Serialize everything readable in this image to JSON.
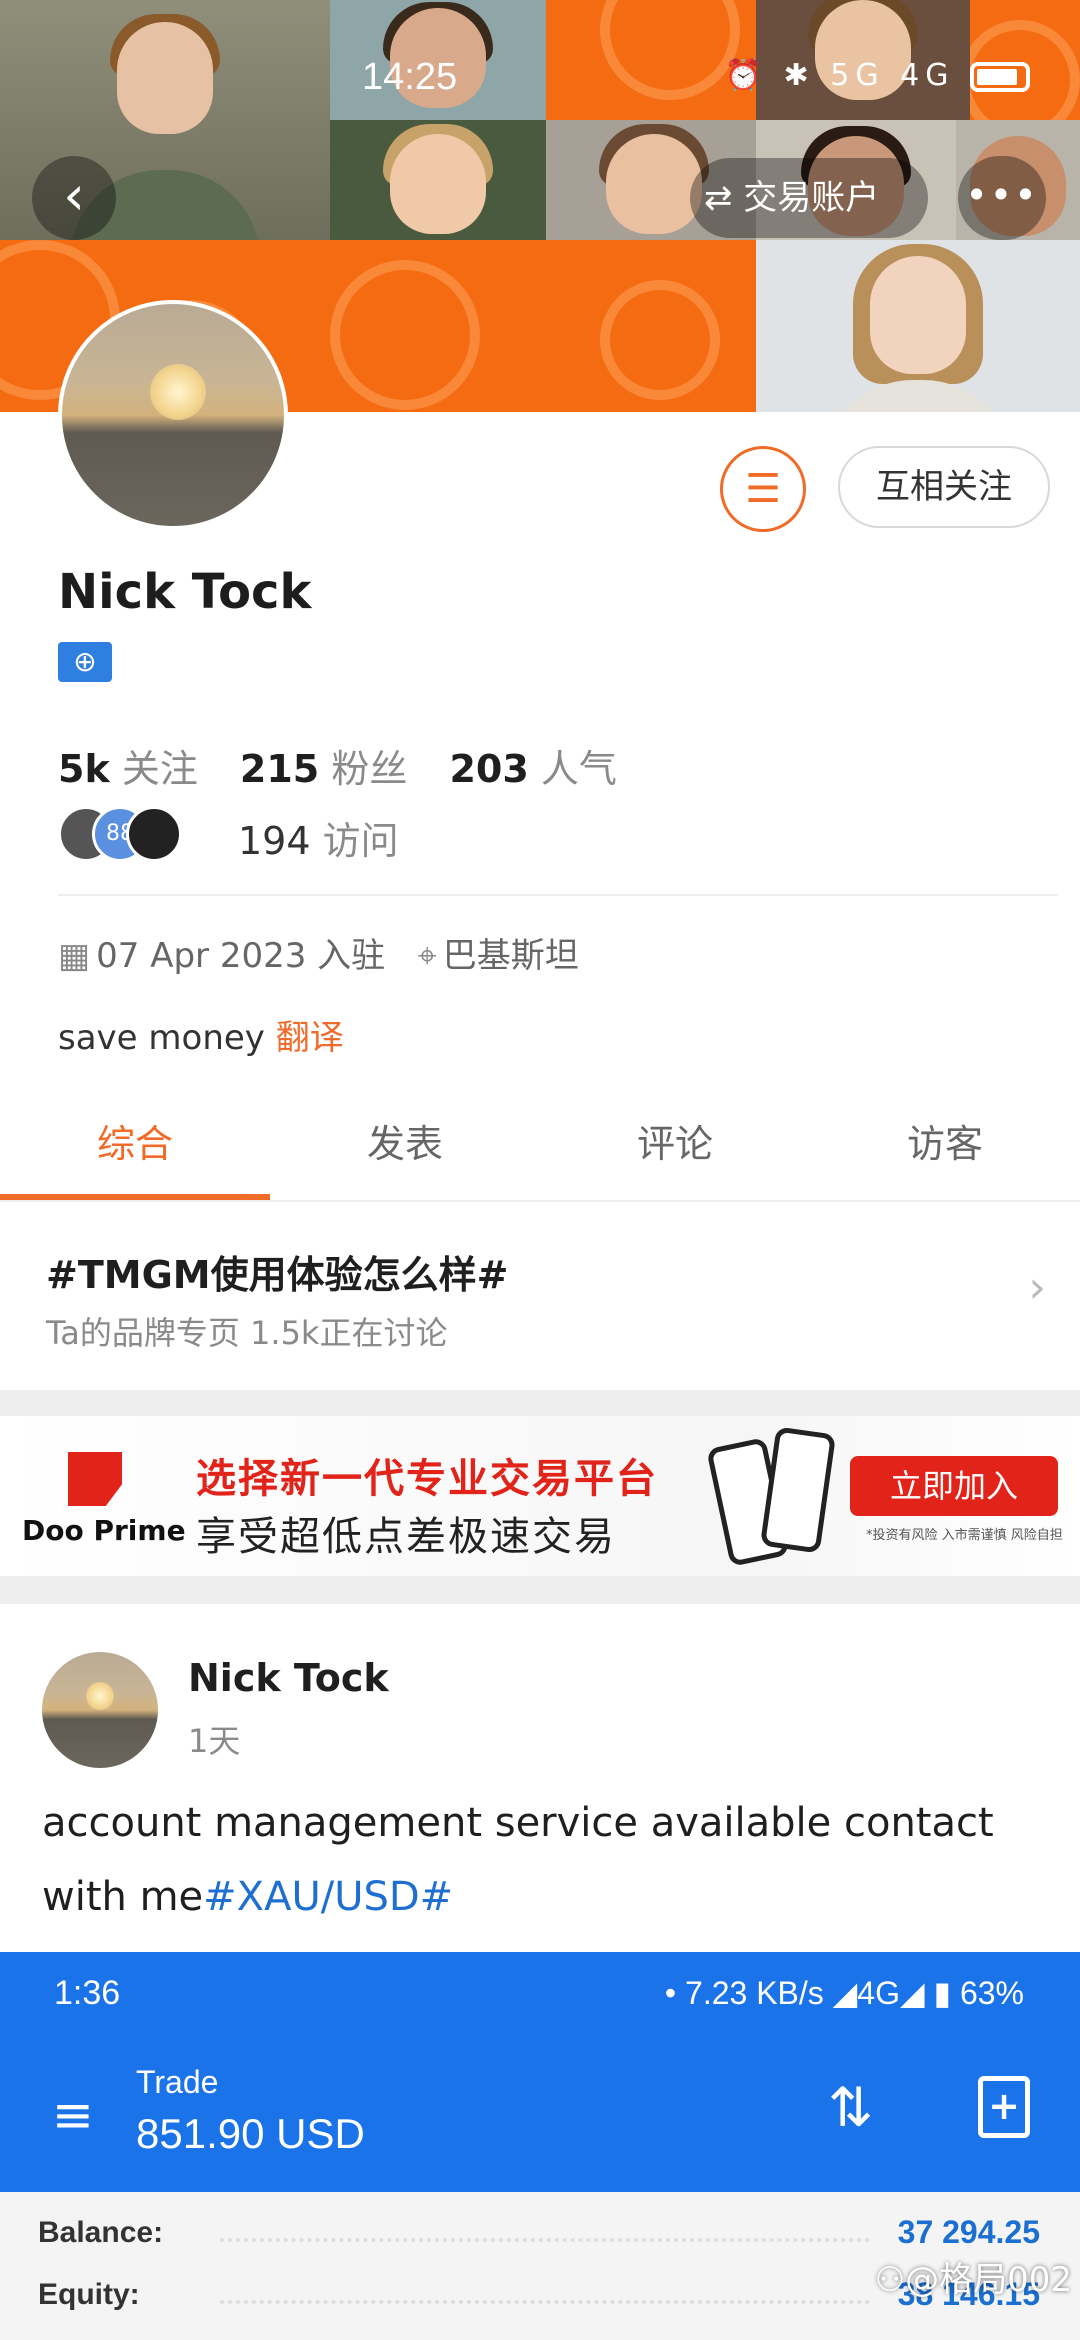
{
  "status_bar": {
    "time": "14:25",
    "icons": "⏰ ✱ 5G 4G"
  },
  "header": {
    "account_button": "⇄ 交易账户",
    "more_icon": "•••"
  },
  "profile": {
    "name": "Nick Tock",
    "follow_button": "互相关注",
    "stats": [
      {
        "value": "5k",
        "label": "关注"
      },
      {
        "value": "215",
        "label": "粉丝"
      },
      {
        "value": "203",
        "label": "人气"
      }
    ],
    "visitors_count": "194",
    "visitors_label": "访问",
    "visitor_badge": "88",
    "joined": "07 Apr 2023 入驻",
    "location": "巴基斯坦",
    "bio": "save money",
    "translate": "翻译"
  },
  "tabs": [
    "综合",
    "发表",
    "评论",
    "访客"
  ],
  "topic": {
    "title": "#TMGM使用体验怎么样#",
    "subtitle": "Ta的品牌专页  1.5k正在讨论"
  },
  "ad": {
    "brand": "Doo Prime",
    "headline": "选择新一代专业交易平台",
    "subline": "享受超低点差极速交易",
    "cta": "立即加入",
    "note": "*投资有风险 入市需谨慎 风险自担"
  },
  "post": {
    "author": "Nick Tock",
    "time": "1天",
    "text": "account management service available contact with me",
    "tag": "#XAU/USD#"
  },
  "embedded_screenshot": {
    "time": "1:36",
    "status": "• 7.23 KB/s ◢4G◢ ▮ 63%",
    "label": "Trade",
    "amount": "851.90 USD",
    "rows": [
      {
        "label": "Balance:",
        "value": "37 294.25"
      },
      {
        "label": "Equity:",
        "value": "38 146.15"
      }
    ]
  },
  "watermark": "⚇@格局002",
  "colors": {
    "accent": "#f06a28",
    "banner": "#f46b12",
    "trade_blue": "#1a73e8",
    "link": "#1f6fd1"
  }
}
